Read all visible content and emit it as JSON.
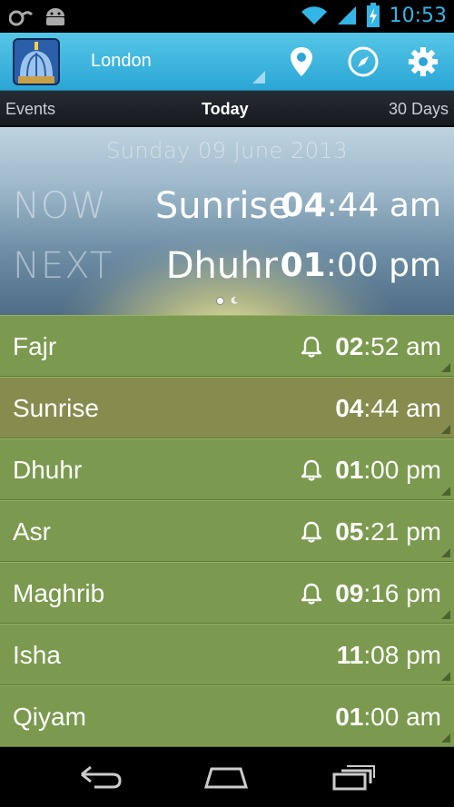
{
  "status_bar": {
    "time": "10:53",
    "left_icons": [
      "usb-notification-icon",
      "android-debug-icon"
    ],
    "right_icons": [
      "wifi-icon",
      "signal-icon",
      "battery-charging-icon"
    ]
  },
  "action_bar": {
    "city": "London",
    "icons": [
      "app-mosque-icon",
      "location-pin-icon",
      "compass-icon",
      "gear-icon"
    ]
  },
  "tabs": [
    {
      "label": "Events",
      "active": false
    },
    {
      "label": "Today",
      "active": true
    },
    {
      "label": "30 Days",
      "active": false
    }
  ],
  "hero": {
    "date": "Sunday 09 June 2013",
    "now_label": "NOW",
    "now_prayer": "Sunrise",
    "now_time_hour": "04",
    "now_time_rest": ":44 am",
    "next_label": "NEXT",
    "next_prayer": "Dhuhr",
    "next_time_hour": "01",
    "next_time_rest": ":00 pm",
    "page_indicator": {
      "count": 2,
      "active": 0
    }
  },
  "prayers": [
    {
      "name": "Fajr",
      "hour": "02",
      "rest": ":52 am",
      "alarm": true,
      "current": false
    },
    {
      "name": "Sunrise",
      "hour": "04",
      "rest": ":44 am",
      "alarm": false,
      "current": true
    },
    {
      "name": "Dhuhr",
      "hour": "01",
      "rest": ":00 pm",
      "alarm": true,
      "current": false
    },
    {
      "name": "Asr",
      "hour": "05",
      "rest": ":21 pm",
      "alarm": true,
      "current": false
    },
    {
      "name": "Maghrib",
      "hour": "09",
      "rest": ":16 pm",
      "alarm": true,
      "current": false
    },
    {
      "name": "Isha",
      "hour": "11",
      "rest": ":08 pm",
      "alarm": false,
      "current": false
    },
    {
      "name": "Qiyam",
      "hour": "01",
      "rest": ":00 am",
      "alarm": false,
      "current": false
    }
  ],
  "nav_bar": {
    "icons": [
      "back-icon",
      "home-icon",
      "recent-apps-icon"
    ]
  },
  "colors": {
    "row": "#7b9a4f",
    "row_current": "#868c4e",
    "accent": "#33b5e5",
    "action_bar": "#2aa6d6"
  }
}
